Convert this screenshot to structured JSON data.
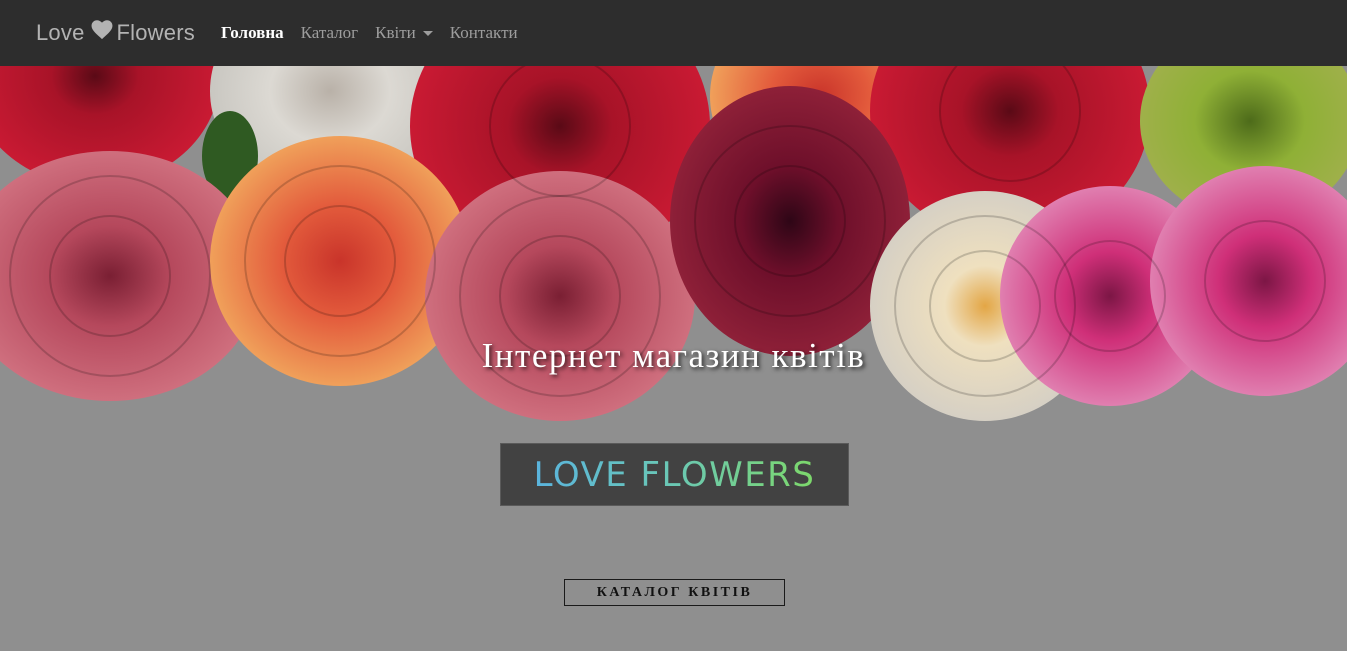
{
  "navbar": {
    "brand_left": "Love",
    "brand_icon": "heart-icon",
    "brand_right": "Flowers",
    "items": [
      {
        "label": "Головна",
        "active": true
      },
      {
        "label": "Каталог",
        "active": false
      },
      {
        "label": "Квіти",
        "active": false,
        "dropdown": true
      },
      {
        "label": "Контакти",
        "active": false
      }
    ]
  },
  "hero": {
    "title": "Інтернет магазин квітів",
    "logo_text": "LOVE FLOWERS",
    "cta_label": "КАТАЛОГ КВІТІВ"
  },
  "colors": {
    "navbar_bg": "#2d2d2d",
    "hero_bg": "#8f8f8f",
    "logo_gradient_start": "#5ab4de",
    "logo_gradient_end": "#7dd86a"
  }
}
